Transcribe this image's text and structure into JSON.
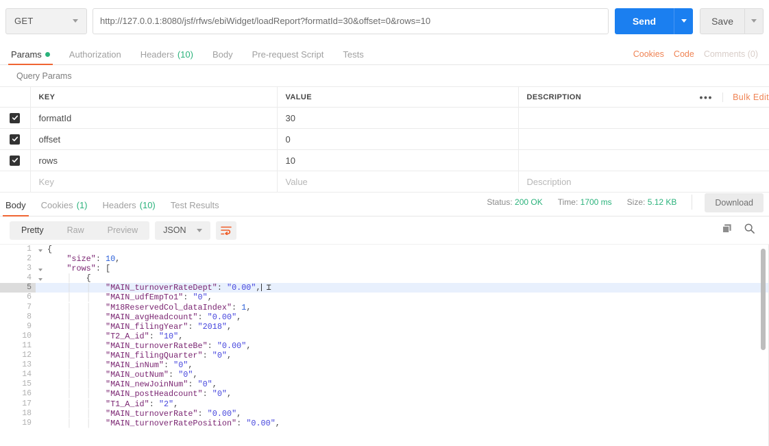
{
  "request": {
    "method": "GET",
    "url": "http://127.0.0.1:8080/jsf/rfws/ebiWidget/loadReport?formatId=30&offset=0&rows=10",
    "send_label": "Send",
    "save_label": "Save",
    "tabs": [
      {
        "label": "Params",
        "badge": "",
        "dot": true,
        "active": true
      },
      {
        "label": "Authorization",
        "badge": "",
        "dot": false,
        "active": false
      },
      {
        "label": "Headers",
        "badge": "(10)",
        "dot": false,
        "active": false
      },
      {
        "label": "Body",
        "badge": "",
        "dot": false,
        "active": false
      },
      {
        "label": "Pre-request Script",
        "badge": "",
        "dot": false,
        "active": false
      },
      {
        "label": "Tests",
        "badge": "",
        "dot": false,
        "active": false
      }
    ],
    "links": {
      "cookies": "Cookies",
      "code": "Code",
      "comments": "Comments (0)"
    }
  },
  "query_params": {
    "section_title": "Query Params",
    "columns": {
      "key": "KEY",
      "value": "VALUE",
      "description": "DESCRIPTION"
    },
    "bulk_edit": "Bulk Edit",
    "dots": "•••",
    "rows": [
      {
        "checked": true,
        "key": "formatId",
        "value": "30",
        "description": ""
      },
      {
        "checked": true,
        "key": "offset",
        "value": "0",
        "description": ""
      },
      {
        "checked": true,
        "key": "rows",
        "value": "10",
        "description": ""
      }
    ],
    "placeholder_row": {
      "key": "Key",
      "value": "Value",
      "description": "Description"
    }
  },
  "response": {
    "tabs": [
      {
        "label": "Body",
        "badge": "",
        "active": true
      },
      {
        "label": "Cookies",
        "badge": "(1)",
        "active": false
      },
      {
        "label": "Headers",
        "badge": "(10)",
        "active": false
      },
      {
        "label": "Test Results",
        "badge": "",
        "active": false
      }
    ],
    "status_label": "Status:",
    "status_value": "200 OK",
    "time_label": "Time:",
    "time_value": "1700 ms",
    "size_label": "Size:",
    "size_value": "5.12 KB",
    "download_label": "Download",
    "view_modes": [
      {
        "label": "Pretty",
        "active": true
      },
      {
        "label": "Raw",
        "active": false
      },
      {
        "label": "Preview",
        "active": false
      }
    ],
    "format": "JSON",
    "icons": {
      "wrap": "word-wrap-icon",
      "copy": "copy-icon",
      "search": "search-icon"
    },
    "code_lines": [
      {
        "n": 1,
        "fold": true,
        "indent": 0,
        "tokens": [
          {
            "t": "p",
            "v": "{"
          }
        ]
      },
      {
        "n": 2,
        "fold": false,
        "indent": 1,
        "tokens": [
          {
            "t": "k",
            "v": "\"size\""
          },
          {
            "t": "p",
            "v": ": "
          },
          {
            "t": "n",
            "v": "10"
          },
          {
            "t": "p",
            "v": ","
          }
        ]
      },
      {
        "n": 3,
        "fold": true,
        "indent": 1,
        "tokens": [
          {
            "t": "k",
            "v": "\"rows\""
          },
          {
            "t": "p",
            "v": ": ["
          }
        ]
      },
      {
        "n": 4,
        "fold": true,
        "indent": 2,
        "tokens": [
          {
            "t": "p",
            "v": "{"
          }
        ]
      },
      {
        "n": 5,
        "fold": false,
        "indent": 3,
        "highlight": true,
        "cursor": true,
        "tokens": [
          {
            "t": "k",
            "v": "\"MAIN_turnoverRateDept\""
          },
          {
            "t": "p",
            "v": ": "
          },
          {
            "t": "s",
            "v": "\"0.00\""
          },
          {
            "t": "p",
            "v": ","
          }
        ]
      },
      {
        "n": 6,
        "fold": false,
        "indent": 3,
        "tokens": [
          {
            "t": "k",
            "v": "\"MAIN_udfEmpTo1\""
          },
          {
            "t": "p",
            "v": ": "
          },
          {
            "t": "s",
            "v": "\"0\""
          },
          {
            "t": "p",
            "v": ","
          }
        ]
      },
      {
        "n": 7,
        "fold": false,
        "indent": 3,
        "tokens": [
          {
            "t": "k",
            "v": "\"M18ReservedCol_dataIndex\""
          },
          {
            "t": "p",
            "v": ": "
          },
          {
            "t": "n",
            "v": "1"
          },
          {
            "t": "p",
            "v": ","
          }
        ]
      },
      {
        "n": 8,
        "fold": false,
        "indent": 3,
        "tokens": [
          {
            "t": "k",
            "v": "\"MAIN_avgHeadcount\""
          },
          {
            "t": "p",
            "v": ": "
          },
          {
            "t": "s",
            "v": "\"0.00\""
          },
          {
            "t": "p",
            "v": ","
          }
        ]
      },
      {
        "n": 9,
        "fold": false,
        "indent": 3,
        "tokens": [
          {
            "t": "k",
            "v": "\"MAIN_filingYear\""
          },
          {
            "t": "p",
            "v": ": "
          },
          {
            "t": "s",
            "v": "\"2018\""
          },
          {
            "t": "p",
            "v": ","
          }
        ]
      },
      {
        "n": 10,
        "fold": false,
        "indent": 3,
        "tokens": [
          {
            "t": "k",
            "v": "\"T2_A_id\""
          },
          {
            "t": "p",
            "v": ": "
          },
          {
            "t": "s",
            "v": "\"10\""
          },
          {
            "t": "p",
            "v": ","
          }
        ]
      },
      {
        "n": 11,
        "fold": false,
        "indent": 3,
        "tokens": [
          {
            "t": "k",
            "v": "\"MAIN_turnoverRateBe\""
          },
          {
            "t": "p",
            "v": ": "
          },
          {
            "t": "s",
            "v": "\"0.00\""
          },
          {
            "t": "p",
            "v": ","
          }
        ]
      },
      {
        "n": 12,
        "fold": false,
        "indent": 3,
        "tokens": [
          {
            "t": "k",
            "v": "\"MAIN_filingQuarter\""
          },
          {
            "t": "p",
            "v": ": "
          },
          {
            "t": "s",
            "v": "\"0\""
          },
          {
            "t": "p",
            "v": ","
          }
        ]
      },
      {
        "n": 13,
        "fold": false,
        "indent": 3,
        "tokens": [
          {
            "t": "k",
            "v": "\"MAIN_inNum\""
          },
          {
            "t": "p",
            "v": ": "
          },
          {
            "t": "s",
            "v": "\"0\""
          },
          {
            "t": "p",
            "v": ","
          }
        ]
      },
      {
        "n": 14,
        "fold": false,
        "indent": 3,
        "tokens": [
          {
            "t": "k",
            "v": "\"MAIN_outNum\""
          },
          {
            "t": "p",
            "v": ": "
          },
          {
            "t": "s",
            "v": "\"0\""
          },
          {
            "t": "p",
            "v": ","
          }
        ]
      },
      {
        "n": 15,
        "fold": false,
        "indent": 3,
        "tokens": [
          {
            "t": "k",
            "v": "\"MAIN_newJoinNum\""
          },
          {
            "t": "p",
            "v": ": "
          },
          {
            "t": "s",
            "v": "\"0\""
          },
          {
            "t": "p",
            "v": ","
          }
        ]
      },
      {
        "n": 16,
        "fold": false,
        "indent": 3,
        "tokens": [
          {
            "t": "k",
            "v": "\"MAIN_postHeadcount\""
          },
          {
            "t": "p",
            "v": ": "
          },
          {
            "t": "s",
            "v": "\"0\""
          },
          {
            "t": "p",
            "v": ","
          }
        ]
      },
      {
        "n": 17,
        "fold": false,
        "indent": 3,
        "tokens": [
          {
            "t": "k",
            "v": "\"T1_A_id\""
          },
          {
            "t": "p",
            "v": ": "
          },
          {
            "t": "s",
            "v": "\"2\""
          },
          {
            "t": "p",
            "v": ","
          }
        ]
      },
      {
        "n": 18,
        "fold": false,
        "indent": 3,
        "tokens": [
          {
            "t": "k",
            "v": "\"MAIN_turnoverRate\""
          },
          {
            "t": "p",
            "v": ": "
          },
          {
            "t": "s",
            "v": "\"0.00\""
          },
          {
            "t": "p",
            "v": ","
          }
        ]
      },
      {
        "n": 19,
        "fold": false,
        "indent": 3,
        "tokens": [
          {
            "t": "k",
            "v": "\"MAIN_turnoverRatePosition\""
          },
          {
            "t": "p",
            "v": ": "
          },
          {
            "t": "s",
            "v": "\"0.00\""
          },
          {
            "t": "p",
            "v": ","
          }
        ]
      }
    ]
  },
  "colors": {
    "accent_orange": "#f06532",
    "link_orange": "#ef8354",
    "send_blue": "#1b7ff0",
    "status_green": "#2ab27b",
    "json_key": "#7a2471",
    "json_string": "#4444dd",
    "json_number": "#2b5fd9",
    "highlight_row": "#e8f0fd"
  }
}
